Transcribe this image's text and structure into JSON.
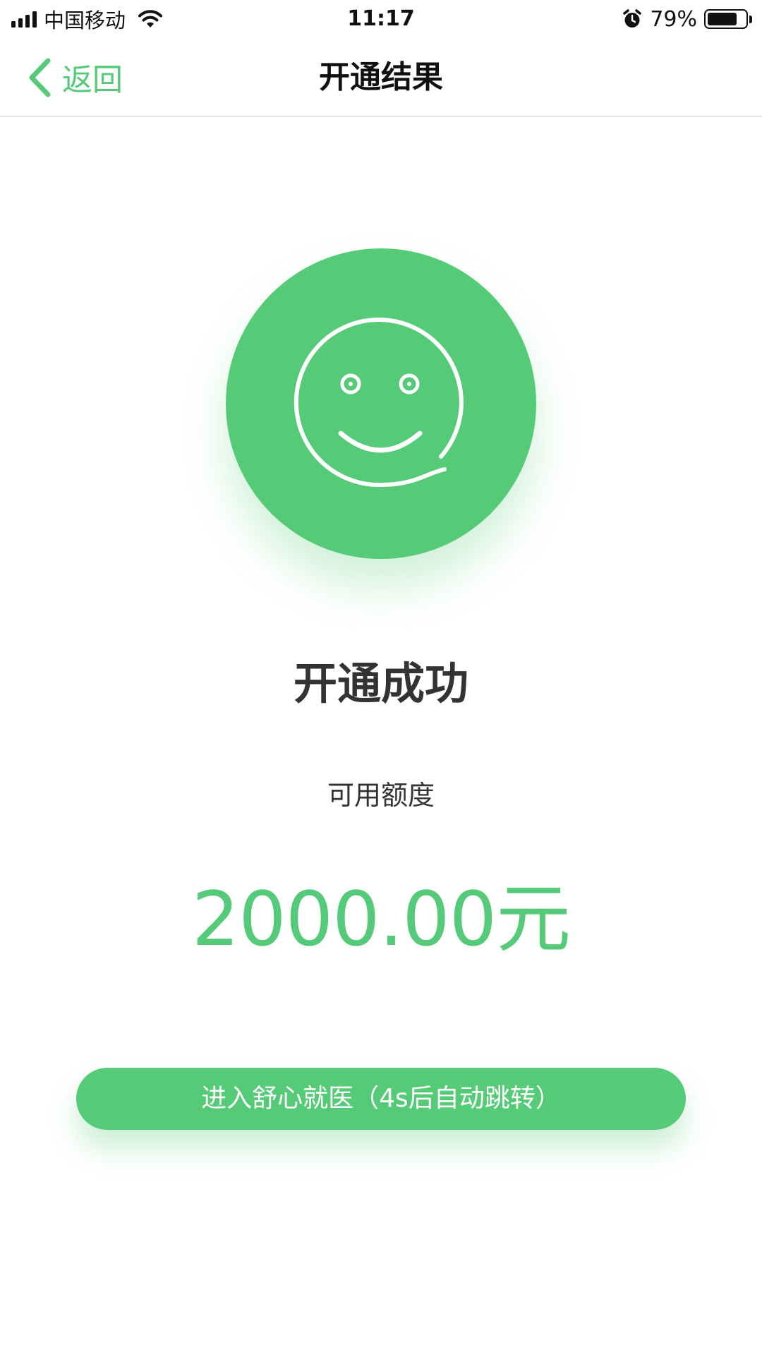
{
  "status_bar": {
    "carrier": "中国移动",
    "time": "11:17",
    "battery_percent": "79%",
    "battery_level": 0.79,
    "icons": [
      "signal-icon",
      "wifi-icon",
      "alarm-icon",
      "battery-icon"
    ]
  },
  "nav": {
    "back_label": "返回",
    "title": "开通结果",
    "back_icon": "chevron-left-icon"
  },
  "result": {
    "icon": "smile-icon",
    "title": "开通成功",
    "quota_label": "可用额度",
    "quota_amount": "2000.00元"
  },
  "action": {
    "button_label": "进入舒心就医（4s后自动跳转）"
  },
  "colors": {
    "accent": "#55cb78",
    "text_dark": "#333333",
    "divider": "#d7d7d7"
  }
}
